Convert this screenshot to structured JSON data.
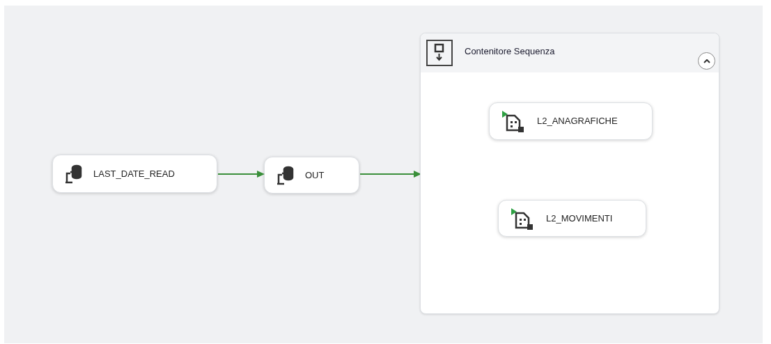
{
  "tasks": [
    {
      "kind": "sql",
      "label": "LAST_DATE_READ"
    },
    {
      "kind": "sql",
      "label": "OUT"
    }
  ],
  "container": {
    "title": "Contenitore Sequenza",
    "expanded": true,
    "tasks": [
      {
        "kind": "dataflow",
        "label": "L2_ANAGRAFICHE"
      },
      {
        "kind": "dataflow",
        "label": "L2_MOVIMENTI"
      }
    ]
  }
}
